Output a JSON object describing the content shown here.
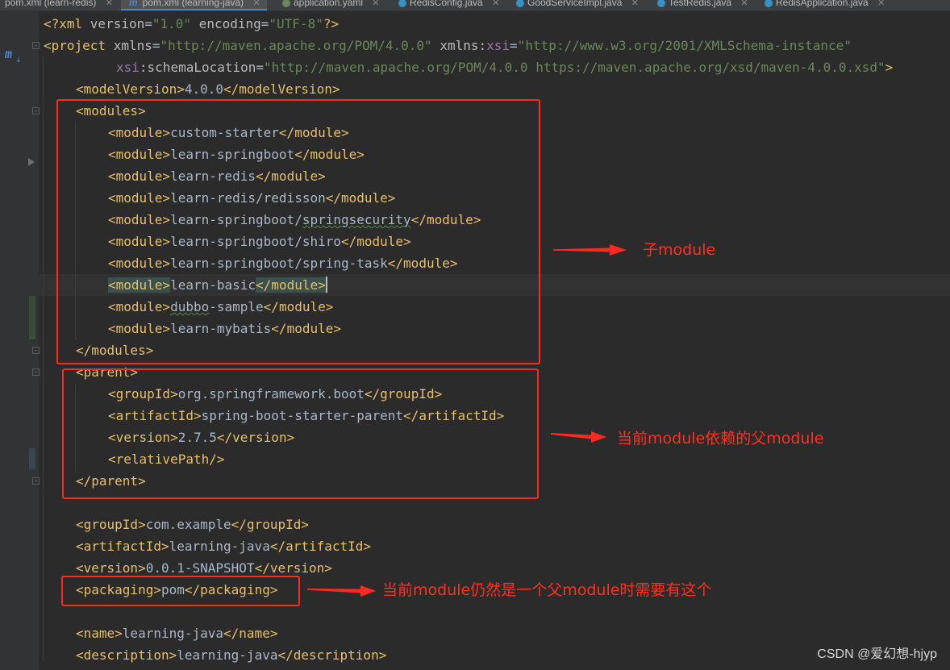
{
  "tabs": [
    {
      "label": "pom.xml (learn-redis)",
      "icon": "maven-file-icon",
      "active": false
    },
    {
      "label": "pom.xml (learning-java)",
      "icon": "maven-file-icon",
      "active": true
    },
    {
      "label": "application.yaml",
      "icon": "yaml-file-icon",
      "active": false
    },
    {
      "label": "RedisConfig.java",
      "icon": "java-class-icon",
      "active": false
    },
    {
      "label": "GoodServiceImpl.java",
      "icon": "java-class-icon",
      "active": false
    },
    {
      "label": "TestRedis.java",
      "icon": "java-class-icon",
      "active": false
    },
    {
      "label": "RedisApplication.java",
      "icon": "java-class-icon",
      "active": false
    }
  ],
  "gutter": {
    "maven_icon": "m"
  },
  "code": {
    "xml_decl": {
      "open": "<?xml ",
      "version_attr": "version",
      "version_val": "\"1.0\"",
      "encoding_attr": "encoding",
      "encoding_val": "\"UTF-8\"",
      "close": "?>"
    },
    "project_open": {
      "tag": "<project ",
      "xmlns_attr": "xmlns",
      "xmlns_val": "\"http://maven.apache.org/POM/4.0.0\"",
      "xsi_prefix": "xmlns:",
      "xsi_name": "xsi",
      "xsi_val": "\"http://www.w3.org/2001/XMLSchema-instance\""
    },
    "schema_line": {
      "prefix": "xsi",
      "attr": ":schemaLocation",
      "val": "\"http://maven.apache.org/POM/4.0.0 https://maven.apache.org/xsd/maven-4.0.0.xsd\"",
      "close": ">"
    },
    "modelVersion": {
      "open": "<modelVersion>",
      "value": "4.0.0",
      "close": "</modelVersion>"
    },
    "modules_open": "<modules>",
    "modules": [
      "custom-starter",
      "learn-springboot",
      "learn-redis",
      "learn-redis/redisson",
      "learn-springboot/springsecurity",
      "learn-springboot/shiro",
      "learn-springboot/spring-task",
      "learn-basic",
      "dubbo-sample",
      "learn-mybatis"
    ],
    "module_open": "<module>",
    "module_close": "</module>",
    "modules_close": "</modules>",
    "parent_open": "<parent>",
    "parent": {
      "groupId": {
        "open": "<groupId>",
        "value": "org.springframework.boot",
        "close": "</groupId>"
      },
      "artifactId": {
        "open": "<artifactId>",
        "value": "spring-boot-starter-parent",
        "close": "</artifactId>"
      },
      "version": {
        "open": "<version>",
        "value": "2.7.5",
        "close": "</version>"
      },
      "relativePath": "<relativePath/>"
    },
    "parent_close": "</parent>",
    "groupId": {
      "open": "<groupId>",
      "value": "com.example",
      "close": "</groupId>"
    },
    "artifactId": {
      "open": "<artifactId>",
      "value": "learning-java",
      "close": "</artifactId>"
    },
    "version": {
      "open": "<version>",
      "value": "0.0.1-SNAPSHOT",
      "close": "</version>"
    },
    "packaging": {
      "open": "<packaging>",
      "value": "pom",
      "close": "</packaging>"
    },
    "name": {
      "open": "<name>",
      "value": "learning-java",
      "close": "</name>"
    },
    "description": {
      "open": "<description>",
      "value": "learning-java",
      "close": "</description>"
    }
  },
  "annotations": {
    "modules_note": "子module",
    "parent_note": "当前module依赖的父module",
    "packaging_note": "当前module仍然是一个父module时需要有这个",
    "color": "#ff2a1f"
  },
  "watermark": "CSDN @爱幻想-hjyp"
}
